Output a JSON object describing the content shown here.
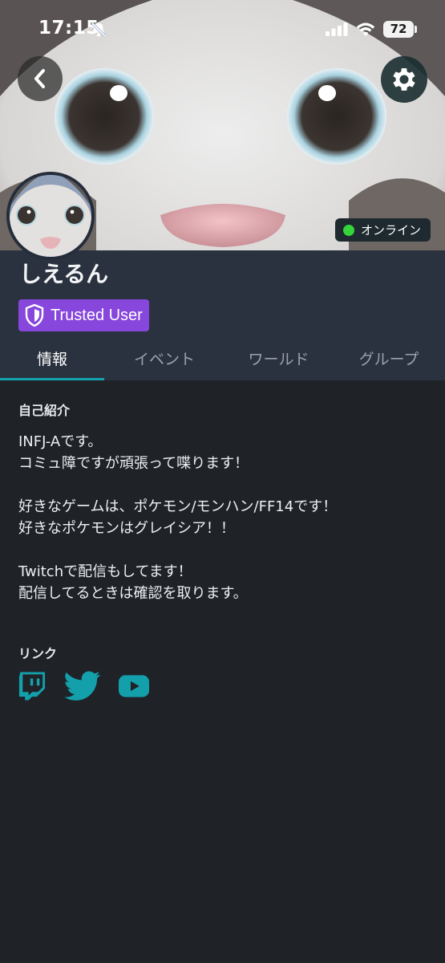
{
  "status_bar": {
    "time": "17:15",
    "battery": "72",
    "icons": [
      "bell-off-icon",
      "signal-icon",
      "wifi-icon",
      "battery-icon"
    ]
  },
  "profile": {
    "display_name": "しえるん",
    "trust_badge": "Trusted User",
    "status": "オンライン",
    "status_color": "#35d43a",
    "trust_color": "#8746dc"
  },
  "tabs": [
    {
      "label": "情報",
      "active": true
    },
    {
      "label": "イベント",
      "active": false
    },
    {
      "label": "ワールド",
      "active": false
    },
    {
      "label": "グループ",
      "active": false
    }
  ],
  "about": {
    "title": "自己紹介",
    "body": "INFJ-Aです。\nコミュ障ですが頑張って喋ります！\n\n好きなゲームは、ポケモン/モンハン/FF14です！\n好きなポケモンはグレイシア！！\n\nTwitchで配信もしてます！\n配信してるときは確認を取ります。"
  },
  "links": {
    "title": "リンク",
    "items": [
      "twitch-icon",
      "twitter-icon",
      "youtube-icon"
    ],
    "color": "#14a0ab"
  },
  "nav": {
    "back": "back-arrow-icon",
    "settings": "gear-icon"
  }
}
